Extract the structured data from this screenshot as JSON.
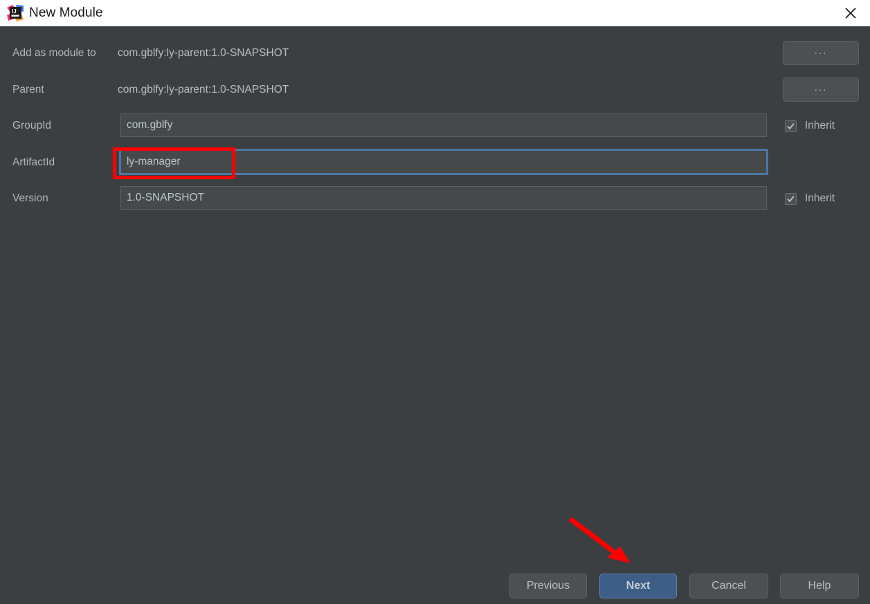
{
  "window": {
    "title": "New Module",
    "logo_icon": "intellij-idea-logo",
    "close_icon": "close-icon"
  },
  "form": {
    "rows": [
      {
        "label": "Add as module to",
        "kind": "static",
        "value": "com.gblfy:ly-parent:1.0-SNAPSHOT",
        "browse_label": "...",
        "has_browse": true,
        "has_inherit": false
      },
      {
        "label": "Parent",
        "kind": "static",
        "value": "com.gblfy:ly-parent:1.0-SNAPSHOT",
        "browse_label": "...",
        "has_browse": true,
        "has_inherit": false
      },
      {
        "label": "GroupId",
        "kind": "input",
        "value": "com.gblfy",
        "placeholder": "",
        "focused": false,
        "has_browse": false,
        "has_inherit": true,
        "inherit_label": "Inherit",
        "inherit_checked": true
      },
      {
        "label": "ArtifactId",
        "kind": "input",
        "value": "ly-manager",
        "placeholder": "",
        "focused": true,
        "has_browse": false,
        "has_inherit": false
      },
      {
        "label": "Version",
        "kind": "input",
        "value": "1.0-SNAPSHOT",
        "placeholder": "",
        "focused": false,
        "has_browse": false,
        "has_inherit": true,
        "inherit_label": "Inherit",
        "inherit_checked": true
      }
    ],
    "checkmark_glyph": "✓"
  },
  "footer": {
    "previous_label": "Previous",
    "next_label": "Next",
    "cancel_label": "Cancel",
    "help_label": "Help"
  },
  "annotations": {
    "highlight_color": "#fe0000",
    "arrow_color": "#fe0000",
    "highlight_target": "artifactid-input",
    "arrow_target": "next-button"
  },
  "colors": {
    "dialog_background": "#3c3f41",
    "titlebar_background": "#ffffff",
    "input_background": "#45494a",
    "focus_border": "#4b77a5",
    "primary_button": "#3c5e87",
    "label_text": "#b5b5b5",
    "value_text": "#bcc6cf"
  }
}
